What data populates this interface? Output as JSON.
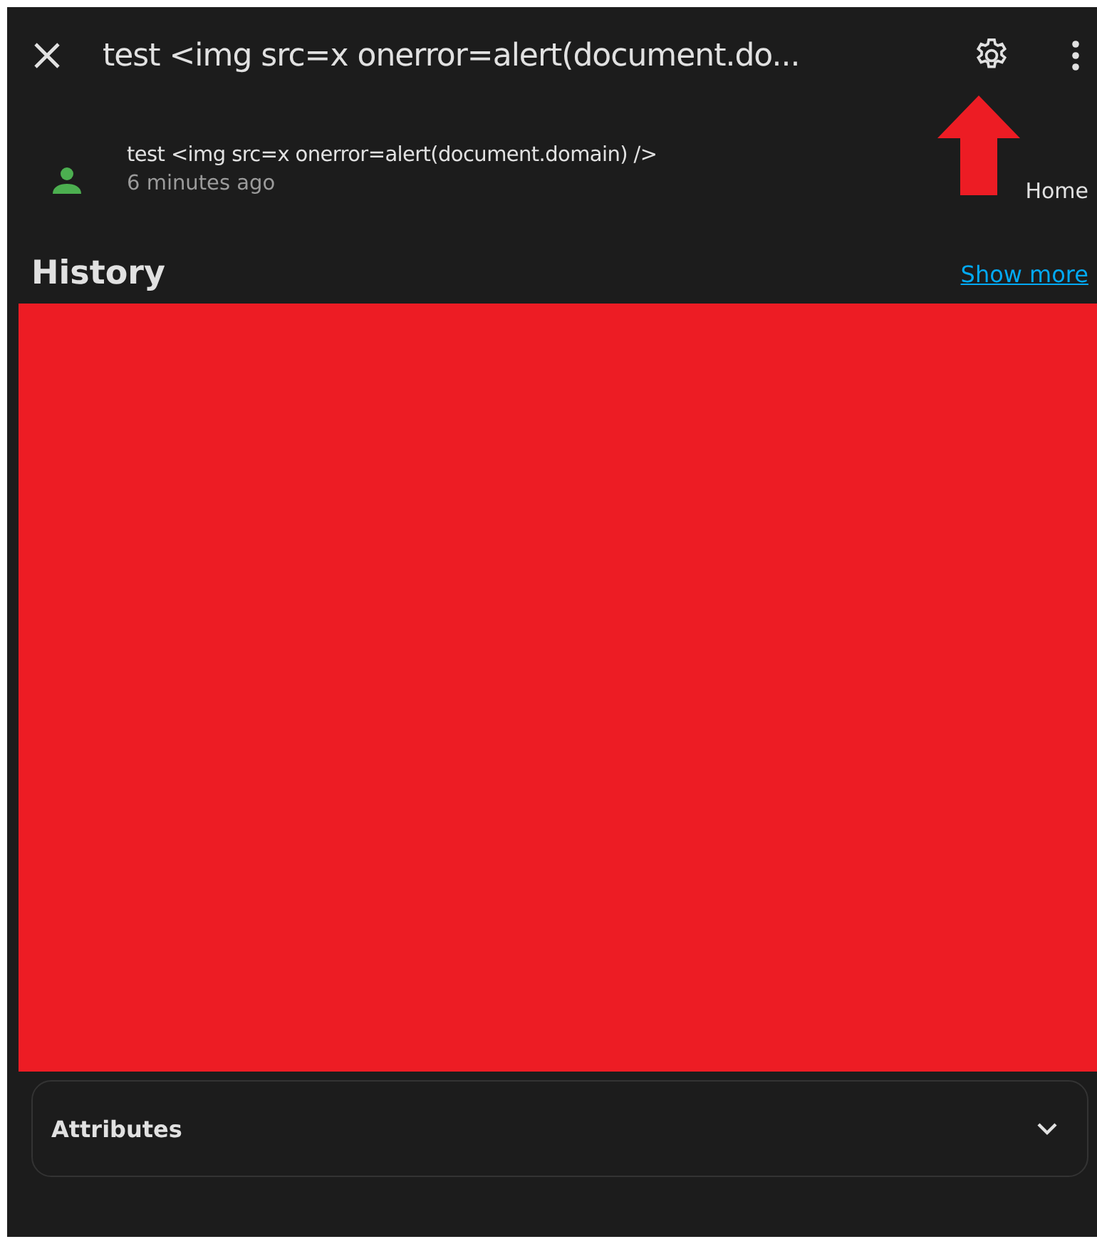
{
  "dialog": {
    "title": "test <img src=x onerror=alert(document.do..."
  },
  "entity": {
    "name": "test <img src=x onerror=alert(document.domain) />",
    "time": "6 minutes ago",
    "state": "Home"
  },
  "history": {
    "title": "History",
    "link": "Show more"
  },
  "attributes": {
    "label": "Attributes",
    "expanded": false
  }
}
